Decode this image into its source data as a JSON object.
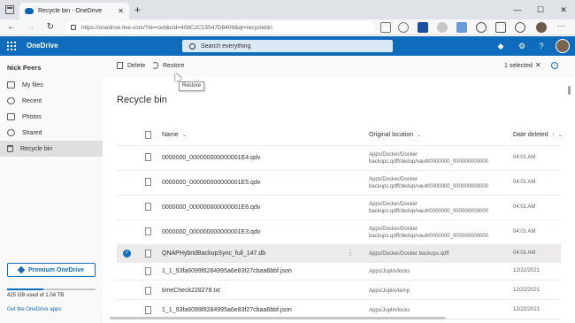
{
  "browser": {
    "tab_title": "Recycle bin - OneDrive",
    "tab_close": "✕",
    "new_tab": "+",
    "url": "https://onedrive.live.com/?id=root&cid=408C2C15547D8409&qt=recyclebin",
    "window_controls": [
      "—",
      "☐",
      "✕"
    ],
    "menu": "···"
  },
  "header": {
    "brand": "OneDrive",
    "search_placeholder": "Search everything"
  },
  "sidebar": {
    "user": "Nick Peers",
    "items": [
      {
        "label": "My files",
        "icon": "folder-icon"
      },
      {
        "label": "Recent",
        "icon": "clock-icon"
      },
      {
        "label": "Photos",
        "icon": "photo-icon"
      },
      {
        "label": "Shared",
        "icon": "people-icon"
      },
      {
        "label": "Recycle bin",
        "icon": "bin-icon"
      }
    ],
    "premium_label": "Premium OneDrive",
    "storage_text": "425 GB used of 1.04 TB",
    "storage_fraction": 0.41,
    "get_apps": "Get the OneDrive apps"
  },
  "commandbar": {
    "delete_label": "Delete",
    "restore_label": "Restore",
    "selected_text": "1 selected",
    "clear_icon": "✕",
    "info_icon": "i"
  },
  "tooltip": "Restore",
  "main": {
    "title": "Recycle bin",
    "columns": {
      "name": "Name",
      "location": "Original location",
      "date": "Date deleted",
      "sort_arrow": "↑"
    },
    "rows": [
      {
        "name": "0000000_000000000000001E4.qdv",
        "loc1": "Apps/Docker/Docker",
        "loc2": "backups.qdff/dedup/vault/0000000_000000000000",
        "date": "04:01 AM"
      },
      {
        "name": "0000000_000000000000001E5.qdv",
        "loc1": "Apps/Docker/Docker",
        "loc2": "backups.qdff/dedup/vault/0000000_000000000000",
        "date": "04:01 AM"
      },
      {
        "name": "0000000_000000000000001E6.qdv",
        "loc1": "Apps/Docker/Docker",
        "loc2": "backups.qdff/dedup/vault/0000000_000000000000",
        "date": "04:01 AM"
      },
      {
        "name": "0000000_000000000000001E3.qdv",
        "loc1": "Apps/Docker/Docker",
        "loc2": "backups.qdff/dedup/vault/0000000_000000000000",
        "date": "04:01 AM"
      },
      {
        "name": "QNAPHybridBackupSync_full_147.db",
        "loc1": "Apps/Docker/Docker backups.qdff",
        "loc2": "",
        "date": "04:01 AM",
        "more": "⋮"
      },
      {
        "name": "1_1_93fa6099f8284995a6e83f27cbaa6bbf.json",
        "loc1": "Apps/Joplin/locks",
        "loc2": "",
        "date": "12/22/2021"
      },
      {
        "name": "timeCheck228278.txt",
        "loc1": "Apps/Joplin/temp",
        "loc2": "",
        "date": "12/22/2021"
      },
      {
        "name": "1_1_93fa6099f8284995a6e83f27cbaa6bbf.json",
        "loc1": "Apps/Joplin/locks",
        "loc2": "",
        "date": "12/22/2021"
      }
    ]
  }
}
